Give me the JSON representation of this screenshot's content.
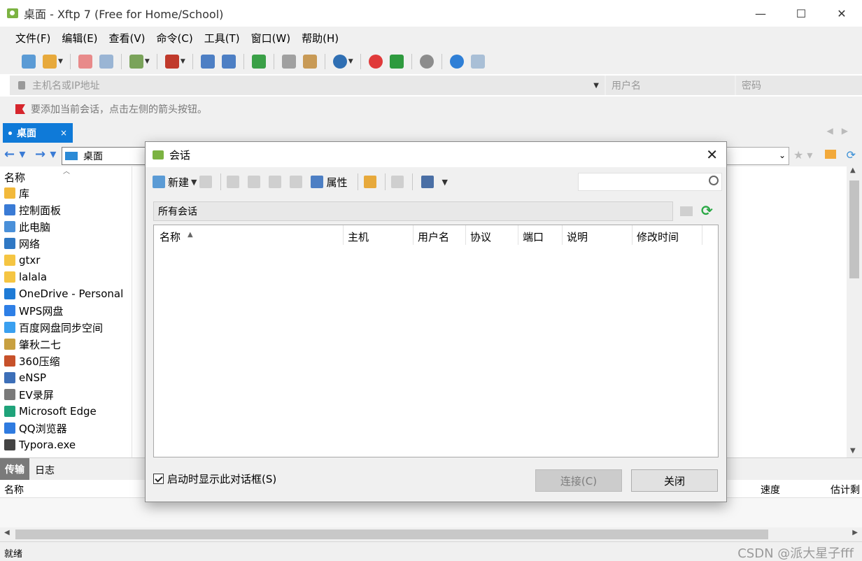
{
  "window": {
    "title": "桌面 - Xftp 7 (Free for Home/School)",
    "min": "—",
    "max": "☐",
    "close": "✕"
  },
  "menu": [
    "文件(F)",
    "编辑(E)",
    "查看(V)",
    "命令(C)",
    "工具(T)",
    "窗口(W)",
    "帮助(H)"
  ],
  "address": {
    "host_placeholder": "主机名或IP地址",
    "user_placeholder": "用户名",
    "pass_placeholder": "密码"
  },
  "hint": "要添加当前会话，点击左侧的箭头按钮。",
  "tab": {
    "label": "桌面",
    "close": "×"
  },
  "path": {
    "current": "桌面"
  },
  "filelist": {
    "header": "名称",
    "items": [
      {
        "label": "库",
        "icon": "library-icon",
        "color": "#f2b93b"
      },
      {
        "label": "控制面板",
        "icon": "control-panel-icon",
        "color": "#3a7bd5"
      },
      {
        "label": "此电脑",
        "icon": "computer-icon",
        "color": "#4a90d9"
      },
      {
        "label": "网络",
        "icon": "network-icon",
        "color": "#2f78c4"
      },
      {
        "label": "gtxr",
        "icon": "folder-icon",
        "color": "#f5c542"
      },
      {
        "label": "lalala",
        "icon": "folder-icon",
        "color": "#f5c542"
      },
      {
        "label": "OneDrive - Personal",
        "icon": "onedrive-icon",
        "color": "#1e7bd6"
      },
      {
        "label": "WPS网盘",
        "icon": "wps-cloud-icon",
        "color": "#2e7fe6"
      },
      {
        "label": "百度网盘同步空间",
        "icon": "baidu-netdisk-icon",
        "color": "#3aa0f0"
      },
      {
        "label": "肇秋二七",
        "icon": "user-folder-icon",
        "color": "#c8a040"
      },
      {
        "label": "360压缩",
        "icon": "360zip-icon",
        "color": "#c7512a"
      },
      {
        "label": "eNSP",
        "icon": "ensp-icon",
        "color": "#3d6fb8"
      },
      {
        "label": "EV录屏",
        "icon": "ev-recorder-icon",
        "color": "#7a7a7a"
      },
      {
        "label": "Microsoft Edge",
        "icon": "edge-icon",
        "color": "#1fa37a"
      },
      {
        "label": "QQ浏览器",
        "icon": "qq-browser-icon",
        "color": "#2f7be0"
      },
      {
        "label": "Typora.exe",
        "icon": "typora-icon",
        "color": "#444444"
      }
    ]
  },
  "transfer": {
    "tab_transfer": "传输",
    "tab_log": "日志",
    "col_name": "名称",
    "col_speed": "速度",
    "col_eta": "估计剩"
  },
  "status": {
    "text": "就绪",
    "watermark": "CSDN @派大星子fff"
  },
  "dialog": {
    "title": "会话",
    "close": "✕",
    "toolbar": {
      "new": "新建",
      "properties": "属性"
    },
    "path": "所有会话",
    "columns": [
      "名称",
      "主机",
      "用户名",
      "协议",
      "端口",
      "说明",
      "修改时间"
    ],
    "checkbox_label": "启动时显示此对话框(S)",
    "btn_connect": "连接(C)",
    "btn_close": "关闭"
  }
}
